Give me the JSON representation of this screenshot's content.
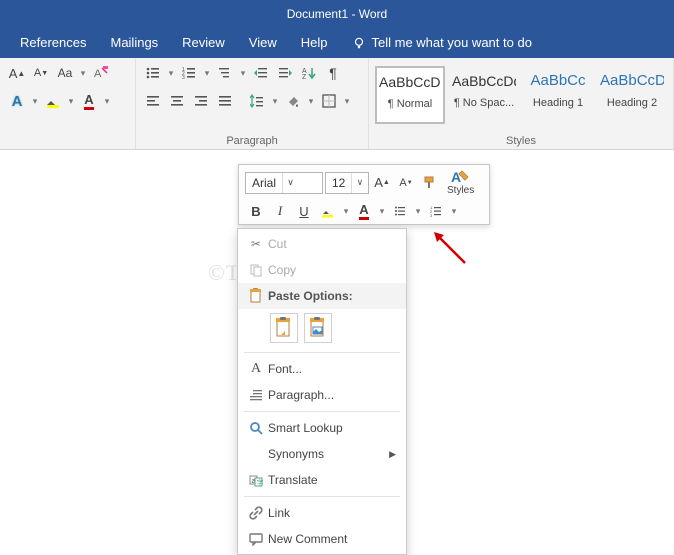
{
  "title": "Document1  -  Word",
  "tabs": {
    "references": "References",
    "mailings": "Mailings",
    "review": "Review",
    "view": "View",
    "help": "Help",
    "tellme": "Tell me what you want to do"
  },
  "ribbon": {
    "paragraph_label": "Paragraph",
    "styles_label": "Styles",
    "styles": [
      {
        "sample": "AaBbCcDd",
        "name": "¶ Normal",
        "selected": true,
        "heading": false
      },
      {
        "sample": "AaBbCcDd",
        "name": "¶ No Spac...",
        "selected": false,
        "heading": false
      },
      {
        "sample": "AaBbCc",
        "name": "Heading 1",
        "selected": false,
        "heading": true
      },
      {
        "sample": "AaBbCcD",
        "name": "Heading 2",
        "selected": false,
        "heading": true
      }
    ]
  },
  "mini": {
    "font": "Arial",
    "size": "12",
    "styles_label": "Styles"
  },
  "ctx": {
    "cut": "Cut",
    "copy": "Copy",
    "paste_header": "Paste Options:",
    "font": "Font...",
    "paragraph": "Paragraph...",
    "smart": "Smart Lookup",
    "synonyms": "Synonyms",
    "translate": "Translate",
    "link": "Link",
    "comment": "New Comment"
  },
  "watermark": "©TheGeekPage.com"
}
